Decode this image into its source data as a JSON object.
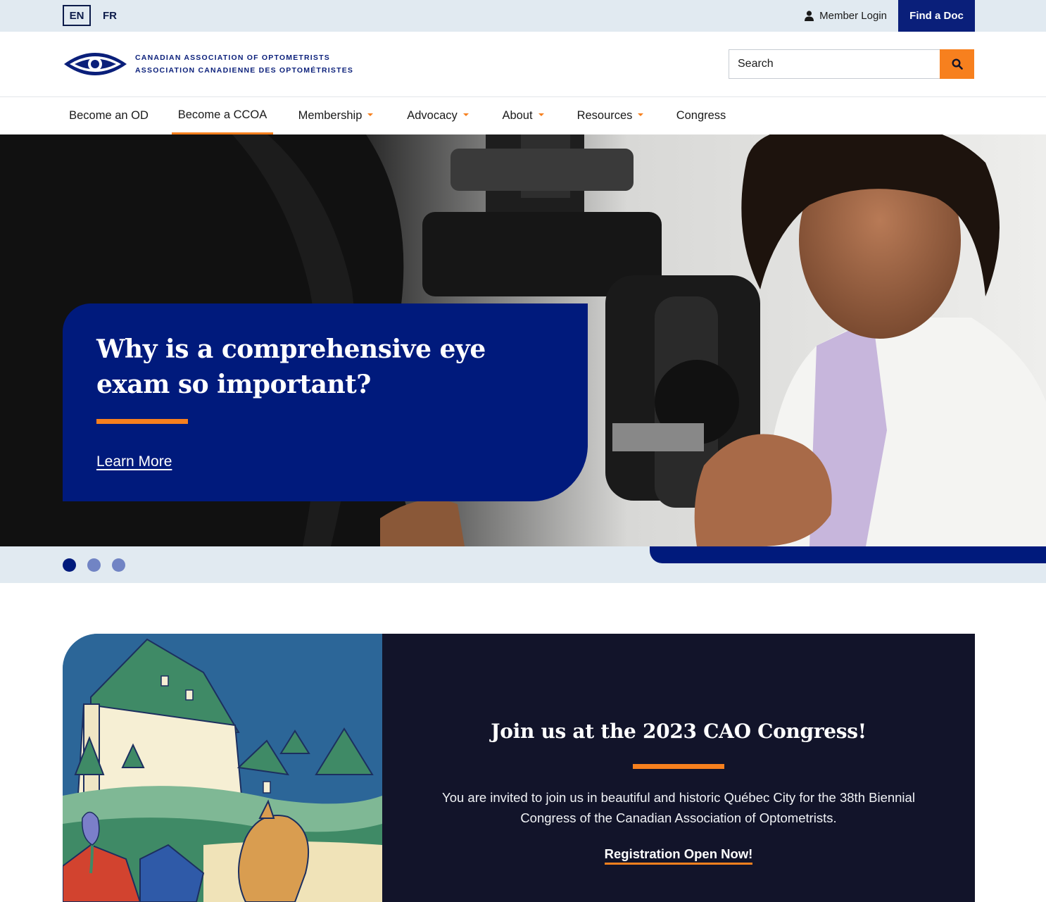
{
  "utility": {
    "lang_en": "EN",
    "lang_fr": "FR",
    "member_login": "Member Login",
    "find_a_doc": "Find a Doc"
  },
  "header": {
    "logo_line1": "CANADIAN ASSOCIATION OF OPTOMETRISTS",
    "logo_line2": "ASSOCIATION CANADIENNE DES OPTOMÉTRISTES",
    "search_placeholder": "Search"
  },
  "nav": {
    "items": [
      {
        "label": "Become an OD",
        "dropdown": false,
        "active": false
      },
      {
        "label": "Become a CCOA",
        "dropdown": false,
        "active": true
      },
      {
        "label": "Membership",
        "dropdown": true,
        "active": false
      },
      {
        "label": "Advocacy",
        "dropdown": true,
        "active": false
      },
      {
        "label": "About",
        "dropdown": true,
        "active": false
      },
      {
        "label": "Resources",
        "dropdown": true,
        "active": false
      },
      {
        "label": "Congress",
        "dropdown": false,
        "active": false
      }
    ]
  },
  "hero": {
    "title": "Why is a comprehensive eye exam so important?",
    "link": "Learn More",
    "slides": 3,
    "active_slide": 1
  },
  "congress": {
    "title": "Join us at the 2023 CAO Congress!",
    "body": "You are invited to join us in beautiful and historic Québec City for the 38th Biennial Congress of the Canadian Association of Optometrists.",
    "link": "Registration Open Now!"
  },
  "colors": {
    "navy": "#001a7c",
    "orange": "#f7801e",
    "light_blue": "#e1eaf1",
    "dark_panel": "#12142a"
  }
}
